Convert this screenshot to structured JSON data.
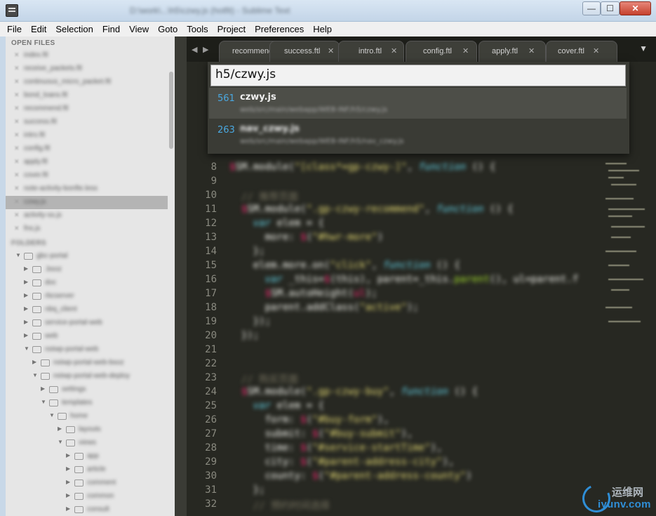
{
  "window": {
    "title": "D:\\work\\...\\h5\\czwy.js (hotfit) - Sublime Text",
    "min_glyph": "—",
    "max_glyph": "☐",
    "close_glyph": "✕"
  },
  "menu": [
    "File",
    "Edit",
    "Selection",
    "Find",
    "View",
    "Goto",
    "Tools",
    "Project",
    "Preferences",
    "Help"
  ],
  "sidebar": {
    "open_files_header": "OPEN FILES",
    "folders_header": "FOLDERS",
    "open_files": [
      "index.ftl",
      "receive_packets.ftl",
      "continuous_micro_packet.ftl",
      "bond_loans.ftl",
      "recommend.ftl",
      "success.ftl",
      "intro.ftl",
      "config.ftl",
      "apply.ftl",
      "cover.ftl",
      "note-activity-bonfte.less",
      "czwy.js",
      "activity-ss.js",
      "fns.js"
    ],
    "folders": [
      "gbc-portal",
      ".bsoz",
      "doc",
      "rbcserver",
      "nbq_client",
      "service-portal-web",
      "web",
      "nstwp-portal-web",
      "nstwp-portal-web-bsoz",
      "nstwp-portal-web-deploy",
      "settings",
      "templates",
      "home",
      "layouts",
      "views",
      "app",
      "article",
      "comment",
      "common",
      "consult"
    ]
  },
  "tabs": {
    "prev_glyph": "◀",
    "next_glyph": "▶",
    "dropdown_glyph": "▼",
    "items": [
      {
        "label": "recommend.ftl"
      },
      {
        "label": "success.ftl"
      },
      {
        "label": "intro.ftl"
      },
      {
        "label": "config.ftl"
      },
      {
        "label": "apply.ftl"
      },
      {
        "label": "cover.ftl"
      }
    ]
  },
  "goto": {
    "query": "h5/czwy.js",
    "results": [
      {
        "num": "561",
        "title": "czwy.js",
        "path": "web/src/main/webapp/WEB-INF/h5/czwy.js"
      },
      {
        "num": "263",
        "title": "nav_czwy.js",
        "path": "web/src/main/webapp/WEB-INF/h5/nav_czwy.js"
      }
    ]
  },
  "gutter": [
    "8",
    "9",
    "10",
    "11",
    "12",
    "13",
    "14",
    "15",
    "16",
    "17",
    "18",
    "19",
    "20",
    "21",
    "22",
    "23",
    "24",
    "25",
    "26",
    "27",
    "28",
    "29",
    "30",
    "31",
    "32"
  ],
  "watermark": {
    "cn": "运维网",
    "en": "iyunv.com"
  }
}
